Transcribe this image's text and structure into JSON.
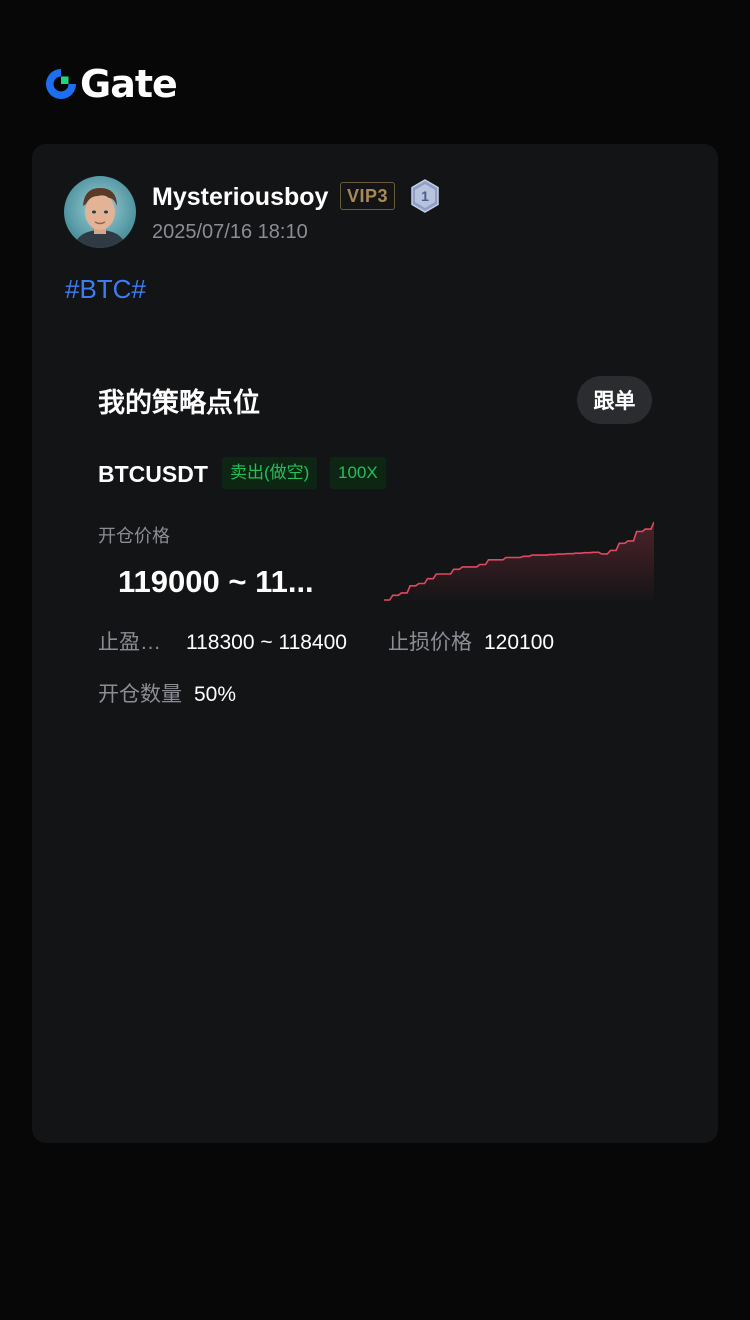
{
  "brand": {
    "name": "Gate",
    "accent": "#1d6ff2"
  },
  "post": {
    "author": "Mysteriousboy",
    "vip": "VIP3",
    "level": "1",
    "timestamp": "2025/07/16 18:10",
    "hashtag": "#BTC#"
  },
  "strategy": {
    "title": "我的策略点位",
    "follow_label": "跟单",
    "symbol": "BTCUSDT",
    "side": "卖出(做空)",
    "leverage": "100X",
    "entry_label": "开仓价格",
    "entry_value": "119000 ~ 11...",
    "tp_label": "止盈…",
    "tp_value": "118300 ~ 118400",
    "sl_label": "止损价格",
    "sl_value": "120100",
    "qty_label": "开仓数量",
    "qty_value": "50%",
    "colors": {
      "side": "#27bd5a",
      "sparkline": "#e0495f",
      "link": "#3d7cf5"
    }
  },
  "sparkline": {
    "type": "line",
    "values": [
      0,
      2,
      3,
      6,
      7,
      9,
      11,
      11,
      13,
      14,
      14,
      15,
      17,
      17,
      18,
      18,
      18.5,
      19,
      19,
      19.2,
      19.4,
      19.6,
      19.8,
      20,
      20.2,
      19.5,
      21,
      24,
      25,
      29,
      30,
      33
    ]
  }
}
